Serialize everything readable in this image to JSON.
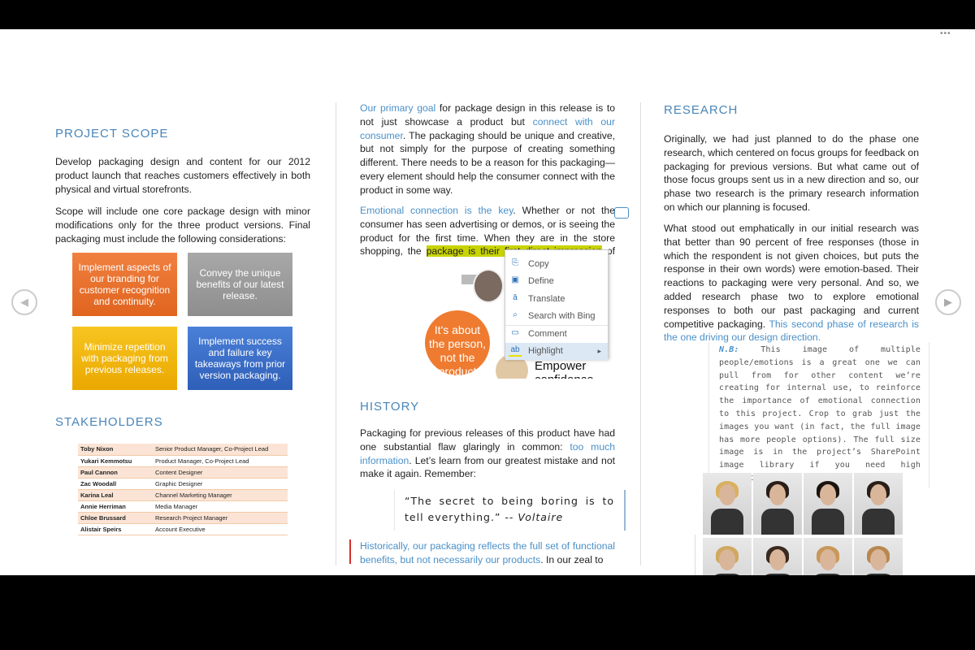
{
  "toolbar": {
    "more_icon": "ellipsis-icon",
    "more_label": "•••"
  },
  "nav": {
    "prev_icon": "chevron-left-icon",
    "next_icon": "chevron-right-icon",
    "prev": "◀",
    "next": "▶"
  },
  "colors": {
    "heading": "#4a86b8",
    "link": "#4a90c8",
    "highlight": "#c8d400",
    "box_orange": "#e8702a",
    "box_gray": "#9a9a9a",
    "box_yellow": "#f0b400",
    "box_blue": "#3a6fc8"
  },
  "left": {
    "scope_title": "PROJECT SCOPE",
    "scope_p1": "Develop packaging design and content for our 2012 product launch that reaches customers effectively in both physical and virtual storefronts.",
    "scope_p2": "Scope will include one core package design with minor modifications only for the three product versions.  Final packaging must include the following considerations:",
    "boxes": [
      "Implement aspects of our branding for customer recognition and continuity.",
      "Convey the unique benefits of our latest release.",
      "Minimize repetition with packaging from previous releases.",
      "Implement success and failure key takeaways from prior version packaging."
    ],
    "stakeholders_title": "STAKEHOLDERS",
    "stakeholders": [
      [
        "Toby Nixon",
        "Senior Product Manager, Co-Project Lead"
      ],
      [
        "Yukari Kemmotsu",
        "Product Manager, Co-Project Lead"
      ],
      [
        "Paul Cannon",
        "Content Designer"
      ],
      [
        "Zac Woodall",
        "Graphic Designer"
      ],
      [
        "Karina Leal",
        "Channel Marketing Manager"
      ],
      [
        "Annie Herriman",
        "Media Manager"
      ],
      [
        "Chloe Brussard",
        "Research Project Manager"
      ],
      [
        "Alistair Speirs",
        "Account Executive"
      ]
    ]
  },
  "middle": {
    "p1_link1": "Our primary goal",
    "p1_a": " for package design in this release is to not just showcase a product but ",
    "p1_link2": "connect with our consumer",
    "p1_b": ". The packaging should be unique and creative, but not simply for the purpose of creating something different. There needs to be a reason for this packaging—every element should help the consumer connect with the product in some way.",
    "p2_link": "Emotional connection is the key",
    "p2_a": ". Whether or not the consumer has seen advertising or demos, or is seeing the product for the first time. When they are in the store shopping, the ",
    "p2_highlight": "package is their first direct impression",
    "p2_b": " of the product.",
    "graphic_circle": "It's about the person, not the product",
    "graphic_label": "Empower confidence",
    "history_title": "HISTORY",
    "h_p1_a": "Packaging for previous releases of this product have had one substantial flaw glaringly in common: ",
    "h_p1_link": "too much information",
    "h_p1_b": ". Let’s learn from our greatest mistake and not make it again. Remember:",
    "quote": "“The secret to being boring is to tell everything.” -- ",
    "quote_author": "Voltaire",
    "h_p2_link": "Historically, our packaging reflects the full set of functional benefits, but not necessarily our products",
    "h_p2_b": ". In our zeal to"
  },
  "context_menu": {
    "items": [
      {
        "label": "Copy",
        "icon": "copy-icon"
      },
      {
        "label": "Define",
        "icon": "define-icon"
      },
      {
        "label": "Translate",
        "icon": "translate-icon"
      },
      {
        "label": "Search with Bing",
        "icon": "search-icon"
      },
      {
        "label": "Comment",
        "icon": "comment-icon"
      },
      {
        "label": "Highlight",
        "icon": "highlight-icon",
        "submenu": true
      }
    ]
  },
  "right": {
    "research_title": "RESEARCH",
    "r_p1": "Originally, we had just planned to do the phase one research, which centered on focus groups for feedback on packaging for previous versions. But what came out of those focus groups sent us in a new direction and so, our phase two research is the primary research information on which our planning is focused.",
    "r_p2_a": "What stood out emphatically in our initial research was that better than 90 percent of free responses (those in which the respondent is not given choices, but puts the response in their own words) were emotion-based. Their reactions to packaging were very personal. And so, we added research phase two to explore emotional responses to both our past packaging and current competitive packaging. ",
    "r_p2_link": "This second phase of research is the one driving our design direction.",
    "nb_label": "N.B:",
    "nb_text": " This image of multiple people/emotions is a great one we can pull from for other content we’re creating for internal use, to reinforce the importance of emotional connection to this project. Crop to grab just the images you want (in fact, the full image has more people options). The full size image is in the project’s SharePoint image library if you need high resolution."
  }
}
